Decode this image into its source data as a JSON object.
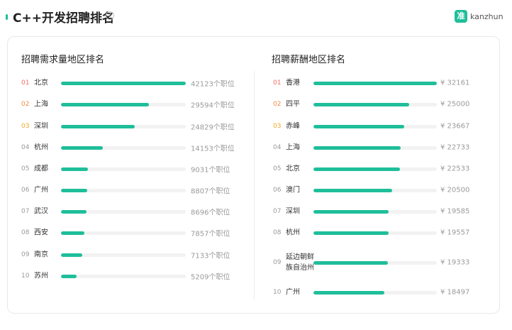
{
  "header": {
    "title": "C++开发招聘排名",
    "help_icon": "question-circle-icon",
    "logo_mark": "准",
    "logo_text": "kanzhun"
  },
  "colors": {
    "accent": "#1fbe9a",
    "rank1": "#f26d5f",
    "rank2": "#f48b48",
    "rank3": "#f5a623",
    "track": "#f2f2f2"
  },
  "demand": {
    "title": "招聘需求量地区排名",
    "items": [
      {
        "rank": "01",
        "city": "北京",
        "value": "42123个职位",
        "count": 42123
      },
      {
        "rank": "02",
        "city": "上海",
        "value": "29594个职位",
        "count": 29594
      },
      {
        "rank": "03",
        "city": "深圳",
        "value": "24829个职位",
        "count": 24829
      },
      {
        "rank": "04",
        "city": "杭州",
        "value": "14153个职位",
        "count": 14153
      },
      {
        "rank": "05",
        "city": "成都",
        "value": "9031个职位",
        "count": 9031
      },
      {
        "rank": "06",
        "city": "广州",
        "value": "8807个职位",
        "count": 8807
      },
      {
        "rank": "07",
        "city": "武汉",
        "value": "8696个职位",
        "count": 8696
      },
      {
        "rank": "08",
        "city": "西安",
        "value": "7857个职位",
        "count": 7857
      },
      {
        "rank": "09",
        "city": "南京",
        "value": "7133个职位",
        "count": 7133
      },
      {
        "rank": "10",
        "city": "苏州",
        "value": "5209个职位",
        "count": 5209
      }
    ]
  },
  "salary": {
    "title": "招聘薪酬地区排名",
    "items": [
      {
        "rank": "01",
        "city": "香港",
        "value": "¥ 32161",
        "amount": 32161
      },
      {
        "rank": "02",
        "city": "四平",
        "value": "¥ 25000",
        "amount": 25000
      },
      {
        "rank": "03",
        "city": "赤峰",
        "value": "¥ 23667",
        "amount": 23667
      },
      {
        "rank": "04",
        "city": "上海",
        "value": "¥ 22733",
        "amount": 22733
      },
      {
        "rank": "05",
        "city": "北京",
        "value": "¥ 22533",
        "amount": 22533
      },
      {
        "rank": "06",
        "city": "澳门",
        "value": "¥ 20500",
        "amount": 20500
      },
      {
        "rank": "07",
        "city": "深圳",
        "value": "¥ 19585",
        "amount": 19585
      },
      {
        "rank": "08",
        "city": "杭州",
        "value": "¥ 19557",
        "amount": 19557
      },
      {
        "rank": "09",
        "city": "延边朝鲜族自治州",
        "value": "¥ 19333",
        "amount": 19333
      },
      {
        "rank": "10",
        "city": "广州",
        "value": "¥ 18497",
        "amount": 18497
      }
    ]
  }
}
